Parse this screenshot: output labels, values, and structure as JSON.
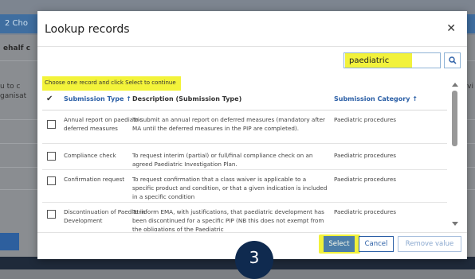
{
  "background": {
    "tab_label": "2 Cho",
    "behalf_text": "ehalf c",
    "left_text_1": "u to c",
    "left_text_2": "ganisat",
    "right_text": "vi"
  },
  "modal": {
    "title": "Lookup records",
    "close_label": "✕",
    "search": {
      "value": "paediatric",
      "placeholder": ""
    },
    "instruction": "Choose one record and click Select to continue",
    "table": {
      "columns": {
        "check": "✔",
        "type": "Submission Type ↑",
        "description": "Description (Submission Type)",
        "category": "Submission Category ↑"
      },
      "rows": [
        {
          "type": "Annual report on paediatric deferred measures",
          "description": "To submit an annual report on deferred measures (mandatory after MA until the deferred measures in the PIP are completed).",
          "category": "Paediatric procedures"
        },
        {
          "type": "Compliance check",
          "description": "To request interim (partial) or full/final compliance check on an agreed Paediatric Investigation Plan.",
          "category": "Paediatric procedures"
        },
        {
          "type": "Confirmation request",
          "description": "To request confirmation that a class waiver is applicable to a specific product and condition, or that a given indication is included in a specific condition",
          "category": "Paediatric procedures"
        },
        {
          "type": "Discontinuation of Paediatric Development",
          "description": "To inform EMA, with justifications, that paediatric development has been discontinued for a specific PIP (NB this does not exempt from the obligations of the Paediatric",
          "category": "Paediatric procedures"
        }
      ]
    },
    "buttons": {
      "select": "Select",
      "cancel": "Cancel",
      "remove": "Remove value"
    }
  },
  "step_badge": "3",
  "colors": {
    "accent": "#2b5fa6",
    "highlight": "#f3f33a",
    "badge": "#0f2a4f"
  }
}
